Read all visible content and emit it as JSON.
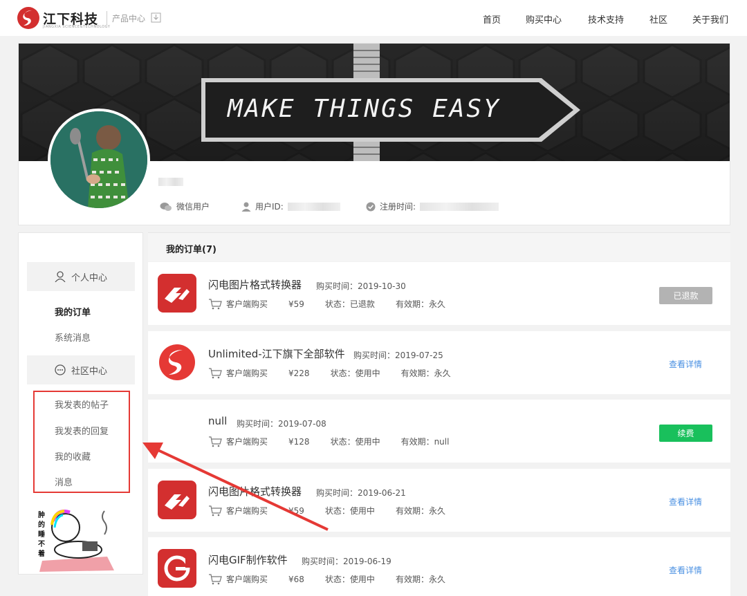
{
  "header": {
    "brand": "江下科技",
    "brand_sub": "JIANGXIA SCIENCE&TECHNOLOGY",
    "product_center": "产品中心",
    "nav": [
      "首页",
      "购买中心",
      "技术支持",
      "社区",
      "关于我们"
    ]
  },
  "banner": {
    "slogan": "MAKE THINGS EASY"
  },
  "profile": {
    "wechat_label": "微信用户",
    "userid_label": "用户ID:",
    "regtime_label": "注册时间:"
  },
  "sidebar": {
    "personal_center": "个人中心",
    "my_orders": "我的订单",
    "system_messages": "系统消息",
    "community_center": "社区中心",
    "my_posts": "我发表的帖子",
    "my_replies": "我发表的回复",
    "my_favorites": "我的收藏",
    "messages": "消息",
    "sticker_text": [
      "肿",
      "的",
      "睡",
      "不",
      "着"
    ]
  },
  "orders": {
    "title": "我的订单(7)",
    "items": [
      {
        "name": "闪电图片格式转换器",
        "purchase_time": "购买时间：2019-10-30",
        "channel": "客户端购买",
        "price": "¥59",
        "status": "状态：已退款",
        "validity": "有效期：永久",
        "action": "已退款",
        "action_type": "gray",
        "icon": "lightning-logo"
      },
      {
        "name": "Unlimited-江下旗下全部软件",
        "purchase_time": "购买时间：2019-07-25",
        "channel": "客户端购买",
        "price": "¥228",
        "status": "状态：使用中",
        "validity": "有效期：永久",
        "action": "查看详情",
        "action_type": "link",
        "icon": "jiangxia-logo"
      },
      {
        "name": "null",
        "purchase_time": "购买时间：2019-07-08",
        "channel": "客户端购买",
        "price": "¥128",
        "status": "状态：使用中",
        "validity": "有效期：null",
        "action": "续费",
        "action_type": "green",
        "icon": "none"
      },
      {
        "name": "闪电图片格式转换器",
        "purchase_time": "购买时间：2019-06-21",
        "channel": "客户端购买",
        "price": "¥59",
        "status": "状态：使用中",
        "validity": "有效期：永久",
        "action": "查看详情",
        "action_type": "link",
        "icon": "lightning-logo"
      },
      {
        "name": "闪电GIF制作软件",
        "purchase_time": "购买时间：2019-06-19",
        "channel": "客户端购买",
        "price": "¥68",
        "status": "状态：使用中",
        "validity": "有效期：永久",
        "action": "查看详情",
        "action_type": "link",
        "icon": "gif-logo"
      }
    ]
  },
  "colors": {
    "accent_red": "#d32f2f",
    "link_blue": "#4a90e2",
    "renew_green": "#19c05c",
    "annotation_red": "#e53935"
  }
}
